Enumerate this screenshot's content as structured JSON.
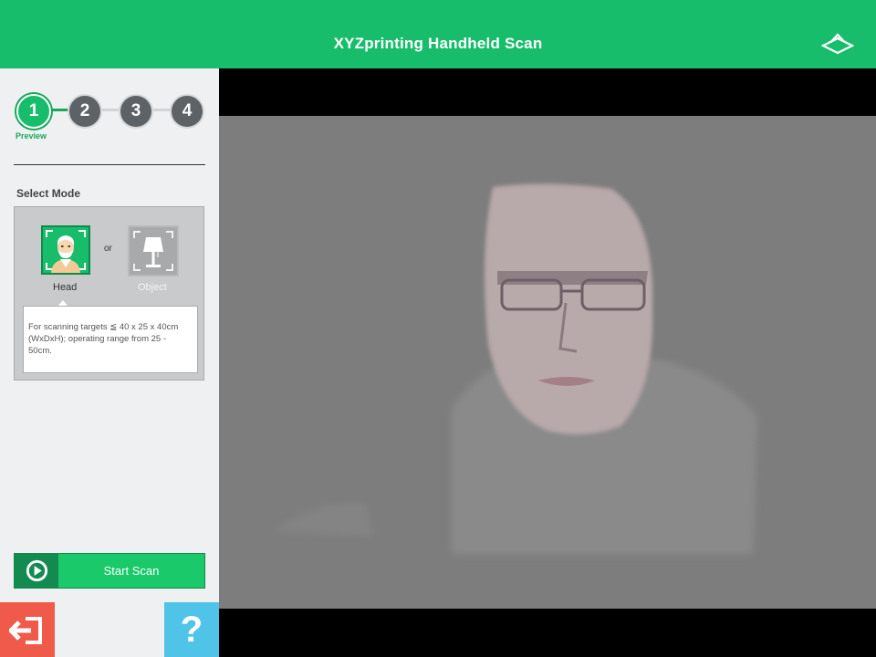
{
  "app": {
    "title": "XYZprinting Handheld Scan"
  },
  "stepper": {
    "steps": [
      "1",
      "2",
      "3",
      "4"
    ],
    "current_caption": "Preview"
  },
  "mode": {
    "section_label": "Select Mode",
    "or_label": "or",
    "options": [
      {
        "label": "Head",
        "icon": "head-icon",
        "selected": true
      },
      {
        "label": "Object",
        "icon": "lamp-icon",
        "selected": false
      }
    ],
    "description": "For scanning targets ≦ 40 x 25 x 40cm (WxDxH); operating range from 25 - 50cm."
  },
  "actions": {
    "start_label": "Start Scan",
    "help_label": "?"
  },
  "colors": {
    "brand": "#17bd6a",
    "exit": "#ef5a4a",
    "help": "#4fc3e8"
  }
}
